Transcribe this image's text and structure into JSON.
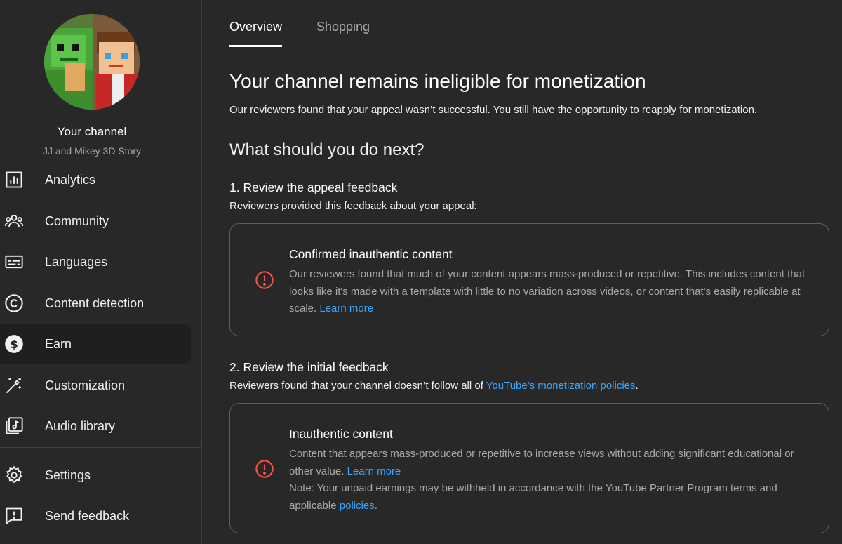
{
  "sidebar": {
    "channel_title": "Your channel",
    "channel_name": "JJ and Mikey 3D Story",
    "items": [
      {
        "label": "Analytics",
        "icon": "analytics-icon"
      },
      {
        "label": "Community",
        "icon": "community-icon"
      },
      {
        "label": "Languages",
        "icon": "languages-icon"
      },
      {
        "label": "Content detection",
        "icon": "copyright-icon"
      },
      {
        "label": "Earn",
        "icon": "dollar-icon",
        "active": true
      },
      {
        "label": "Customization",
        "icon": "magic-wand-icon"
      },
      {
        "label": "Audio library",
        "icon": "audio-library-icon"
      }
    ],
    "footer_items": [
      {
        "label": "Settings",
        "icon": "gear-icon"
      },
      {
        "label": "Send feedback",
        "icon": "feedback-icon"
      }
    ]
  },
  "tabs": [
    {
      "label": "Overview",
      "active": true
    },
    {
      "label": "Shopping",
      "active": false
    }
  ],
  "main": {
    "title": "Your channel remains ineligible for monetization",
    "subtitle": "Our reviewers found that your appeal wasn’t successful. You still have the opportunity to reapply for monetization.",
    "next_heading": "What should you do next?",
    "step1": {
      "heading": "1. Review the appeal feedback",
      "desc": "Reviewers provided this feedback about your appeal:",
      "card": {
        "title": "Confirmed inauthentic content",
        "body": "Our reviewers found that much of your content appears mass-produced or repetitive. This includes content that looks like it's made with a template with little to no variation across videos, or content that's easily replicable at scale.",
        "link": "Learn more"
      }
    },
    "step2": {
      "heading": "2. Review the initial feedback",
      "desc_prefix": "Reviewers found that your channel doesn’t follow all of ",
      "desc_link": "YouTube's monetization policies",
      "desc_suffix": ".",
      "card": {
        "title": "Inauthentic content",
        "body": "Content that appears mass-produced or repetitive to increase views without adding significant educational or other value.",
        "link": "Learn more",
        "note": "Note: Your unpaid earnings may be withheld in accordance with the YouTube Partner Program terms and applicable",
        "note_link": "policies",
        "note_suffix": "."
      }
    }
  },
  "colors": {
    "background": "#282828",
    "link": "#3ea6ff",
    "error": "#ff4e45",
    "active_nav": "#1f1f1f"
  }
}
